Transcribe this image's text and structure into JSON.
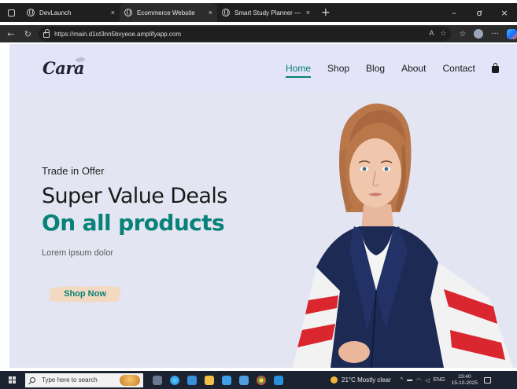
{
  "browser": {
    "tabs": [
      {
        "label": "DevLaunch",
        "active": false
      },
      {
        "label": "Ecommerce Website",
        "active": true
      },
      {
        "label": "Smart Study Planner — Upgrade",
        "active": false
      }
    ],
    "tab_close_glyph": "×",
    "new_tab_glyph": "+",
    "window_controls": [
      "–",
      "ơ",
      "×"
    ],
    "url": "https://main.d1ot3nn5bvyeoe.amplifyapp.com",
    "more_glyph": "···"
  },
  "site": {
    "logo": "Cara",
    "nav": [
      {
        "label": "Home",
        "active": true
      },
      {
        "label": "Shop",
        "active": false
      },
      {
        "label": "Blog",
        "active": false
      },
      {
        "label": "About",
        "active": false
      },
      {
        "label": "Contact",
        "active": false
      }
    ],
    "cart_icon": "shopping-bag-icon",
    "accent_color": "#088178"
  },
  "hero": {
    "kicker": "Trade in Offer",
    "headline": "Super Value Deals",
    "subheadline": "On all products",
    "body": "Lorem ipsum dolor",
    "cta": "Shop Now"
  },
  "taskbar": {
    "search_placeholder": "Type here to search",
    "weather": "21°C  Mostly clear",
    "language": "ENG",
    "time": "23:40",
    "date": "15-10-2025"
  }
}
